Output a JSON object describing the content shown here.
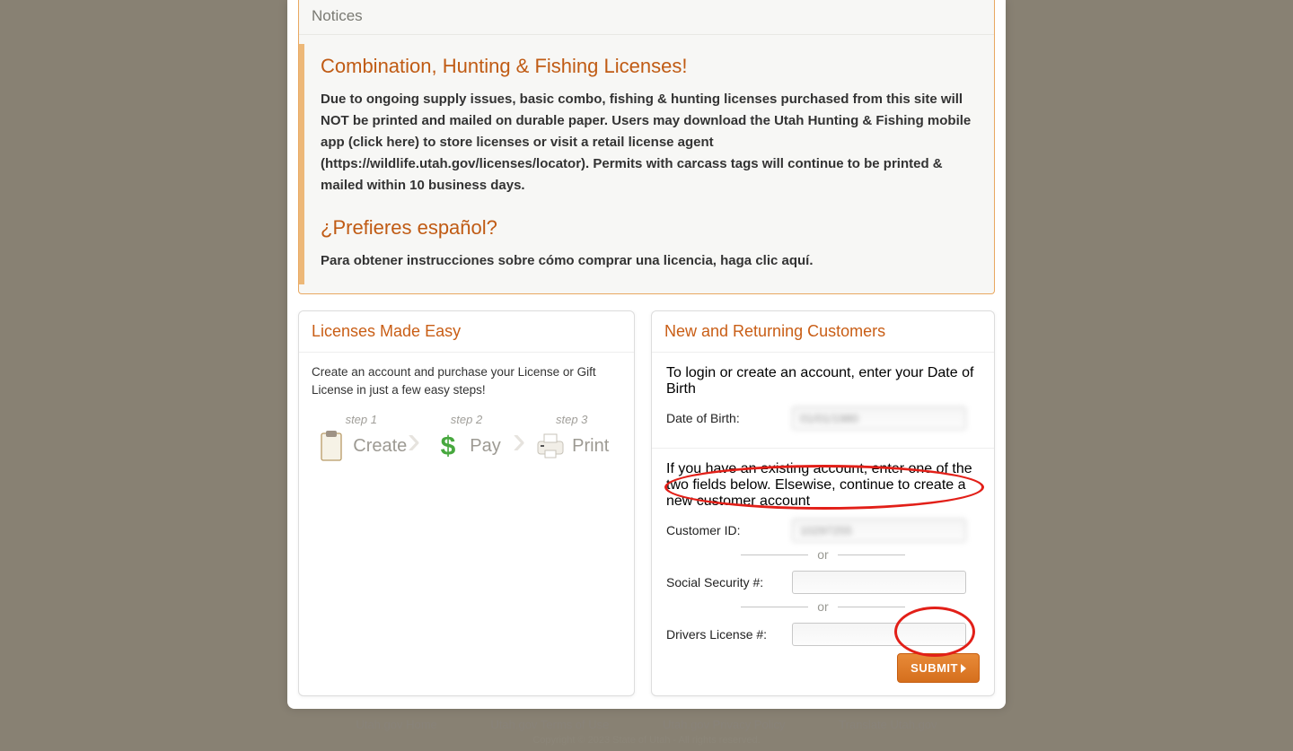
{
  "notices": {
    "tab_label": "Notices",
    "items": [
      {
        "title": "Combination, Hunting & Fishing Licenses!",
        "body": "Due to ongoing supply issues, basic combo, fishing & hunting licenses purchased from this site will NOT be printed and mailed on durable paper. Users may download the Utah Hunting & Fishing mobile app (click here) to store licenses or visit a retail license agent (https://wildlife.utah.gov/licenses/locator). Permits with carcass tags will continue to be printed & mailed within 10 business days."
      },
      {
        "title": "¿Prefieres español?",
        "body": "Para obtener instrucciones sobre cómo comprar una licencia, haga clic aquí."
      }
    ]
  },
  "left_panel": {
    "title": "Licenses Made Easy",
    "intro": "Create an account and purchase your License or Gift License in just a few easy steps!",
    "steps": [
      {
        "top": "step 1",
        "name": "Create"
      },
      {
        "top": "step 2",
        "name": "Pay"
      },
      {
        "top": "step 3",
        "name": "Print"
      }
    ]
  },
  "right_panel": {
    "title": "New and Returning Customers",
    "intro1": "To login or create an account, enter your Date of Birth",
    "dob_label": "Date of Birth:",
    "dob_value": "01/01/1980",
    "intro2": "If you have an existing account, enter one of the two fields below. Elsewise, continue to create a new customer account",
    "customer_id_label": "Customer ID:",
    "customer_id_value": "10297255",
    "ssn_label": "Social Security #:",
    "dl_label": "Drivers License #:",
    "or_text": "or",
    "submit_label": "SUBMIT"
  },
  "footer": {
    "links": [
      "Utah.gov Home",
      "Utah.gov Terms of Use",
      "Utah.gov Privacy Policy",
      "Translate Utah.gov"
    ],
    "copyright": "Copyright © 2023 State of Utah - All rights reserved."
  }
}
